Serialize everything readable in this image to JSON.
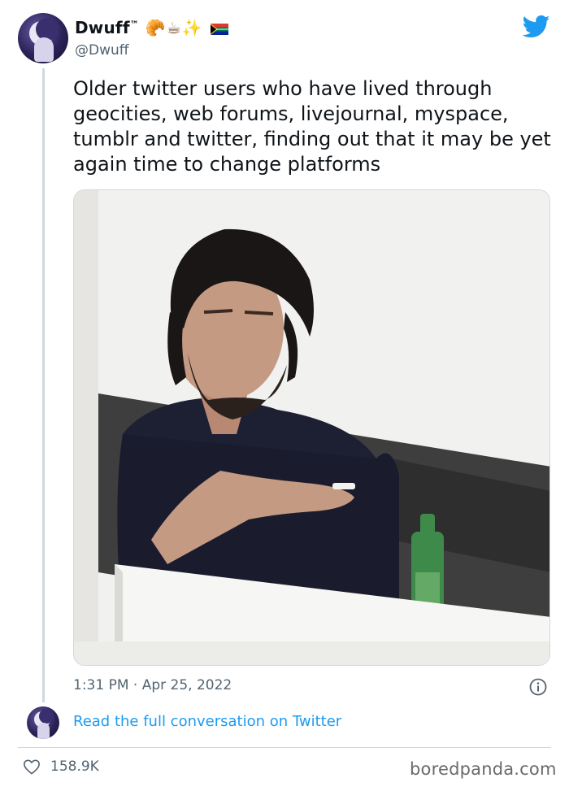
{
  "tweet": {
    "display_name": "Dwuff",
    "trademark": "™",
    "emojis": [
      "🥐",
      "☕",
      "✨"
    ],
    "handle": "@Dwuff",
    "text": "Older twitter users who have lived through geocities, web forums, livejournal, myspace, tumblr and twitter, finding out that it may be yet again time to change platforms",
    "timestamp": "1:31 PM · Apr 25, 2022",
    "read_full": "Read the full conversation on Twitter",
    "likes": "158.9K"
  },
  "icons": {
    "brand": "twitter-bird-icon",
    "info": "info-icon",
    "like": "heart-icon",
    "flag": "south-africa-flag-icon"
  },
  "colors": {
    "twitter_blue": "#1d9bf0",
    "secondary_text": "#536471",
    "border": "#cfd9de"
  },
  "watermark": "boredpanda.com"
}
